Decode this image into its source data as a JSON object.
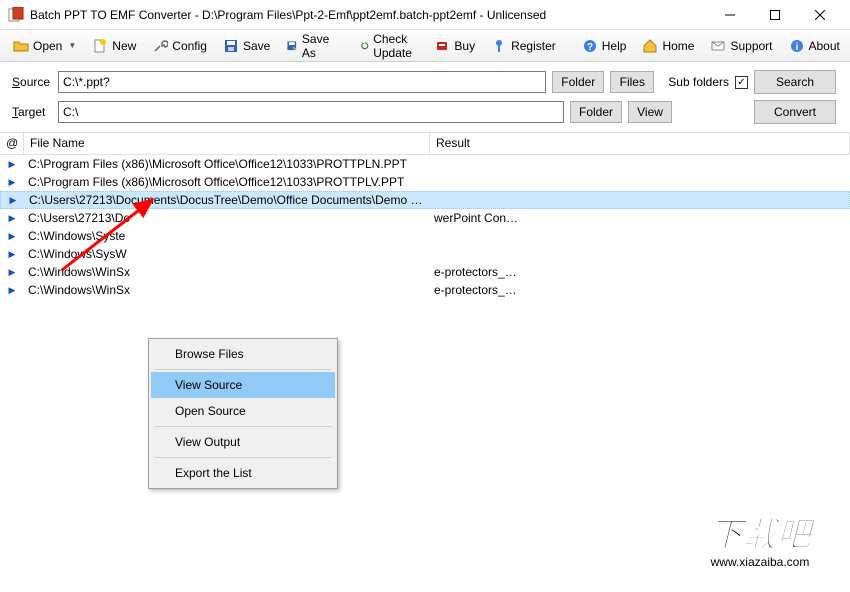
{
  "window": {
    "title": "Batch PPT TO EMF Converter - D:\\Program Files\\Ppt-2-Emf\\ppt2emf.batch-ppt2emf - Unlicensed"
  },
  "toolbar": {
    "open": "Open",
    "new": "New",
    "config": "Config",
    "save": "Save",
    "saveas": "Save As",
    "check_update": "Check Update",
    "buy": "Buy",
    "register": "Register",
    "help": "Help",
    "home": "Home",
    "support": "Support",
    "about": "About"
  },
  "paths": {
    "source_label": "Source",
    "source_value": "C:\\*.ppt?",
    "target_label": "Target",
    "target_value": "C:\\",
    "folder_btn": "Folder",
    "files_btn": "Files",
    "view_btn": "View",
    "subfolders_label": "Sub folders",
    "subfolders_checked": "✓",
    "search_btn": "Search",
    "convert_btn": "Convert"
  },
  "list": {
    "header_at": "@",
    "header_file": "File Name",
    "header_result": "Result",
    "rows": [
      {
        "file": "C:\\Program Files (x86)\\Microsoft Office\\Office12\\1033\\PROTTPLN.PPT",
        "result": "",
        "selected": false
      },
      {
        "file": "C:\\Program Files (x86)\\Microsoft Office\\Office12\\1033\\PROTTPLV.PPT",
        "result": "",
        "selected": false
      },
      {
        "file": "C:\\Users\\27213\\Documents\\DocusTree\\Demo\\Office Documents\\Demo …",
        "result": "",
        "selected": true
      },
      {
        "file": "C:\\Users\\27213\\Do",
        "result": "werPoint Con…",
        "selected": false
      },
      {
        "file": "C:\\Windows\\Syste",
        "result": "",
        "selected": false
      },
      {
        "file": "C:\\Windows\\SysW",
        "result": "",
        "selected": false
      },
      {
        "file": "C:\\Windows\\WinSx",
        "result": "e-protectors_…",
        "selected": false
      },
      {
        "file": "C:\\Windows\\WinSx",
        "result": "e-protectors_…",
        "selected": false
      }
    ]
  },
  "context_menu": {
    "browse_files": "Browse Files",
    "view_source": "View  Source",
    "open_source": "Open Source",
    "view_output": "View  Output",
    "export_list": "Export the List"
  },
  "watermark": {
    "text": "下载吧",
    "url": "www.xiazaiba.com"
  }
}
